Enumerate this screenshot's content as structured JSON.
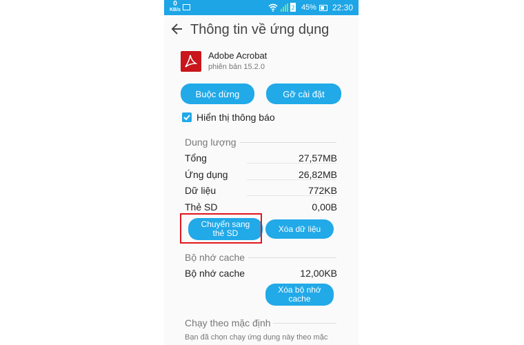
{
  "status_bar": {
    "speed_value": "0",
    "speed_unit": "KB/s",
    "battery": "45%",
    "time": "22:30",
    "icons": [
      "image-icon",
      "wifi-icon",
      "signal-icon",
      "battery-icon"
    ]
  },
  "header": {
    "title": "Thông tin về ứng dụng"
  },
  "app": {
    "name": "Adobe Acrobat",
    "version": "phiên bản 15.2.0"
  },
  "actions": {
    "force_stop": "Buộc dừng",
    "uninstall": "Gỡ cài đặt"
  },
  "notifications": {
    "label": "Hiển thị thông báo",
    "checked": true
  },
  "storage": {
    "title": "Dung lượng",
    "rows": [
      {
        "label": "Tổng",
        "value": "27,57MB"
      },
      {
        "label": "Ứng dụng",
        "value": "26,82MB"
      },
      {
        "label": "Dữ liệu",
        "value": "772KB"
      },
      {
        "label": "Thẻ SD",
        "value": "0,00B"
      }
    ],
    "move_to_sd": "Chuyển sang thẻ SD",
    "clear_data": "Xóa dữ liệu"
  },
  "cache": {
    "title": "Bộ nhớ cache",
    "row": {
      "label": "Bộ nhớ cache",
      "value": "12,00KB"
    },
    "clear_cache": "Xóa bộ nhớ cache"
  },
  "default_launch": {
    "title": "Chạy theo mặc định",
    "description": "Bạn đã chọn chạy ứng dụng này theo mặc"
  },
  "colors": {
    "accent": "#21a9e8",
    "status_bar": "#1ea5e6",
    "highlight": "#e0161c",
    "app_icon": "#c8161c"
  }
}
